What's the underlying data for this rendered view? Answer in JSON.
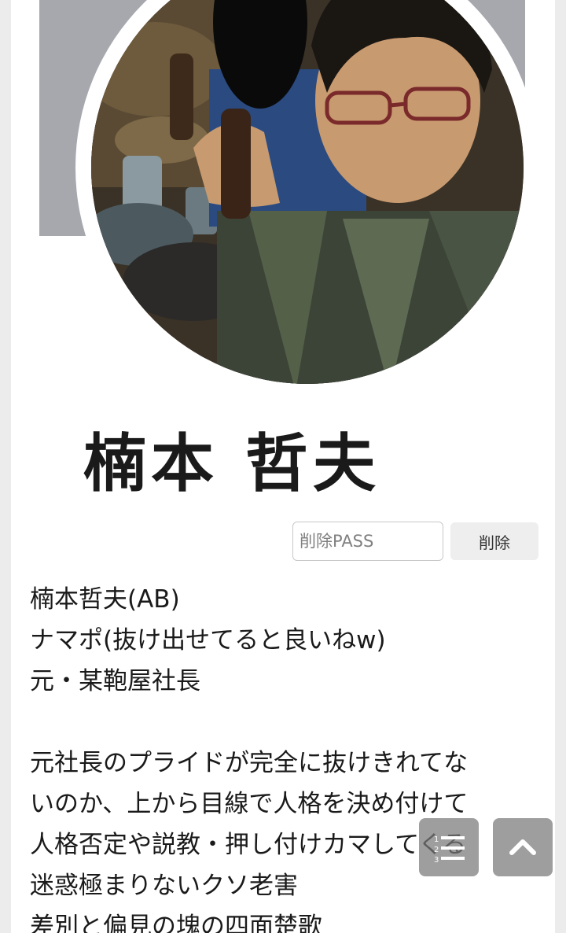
{
  "profile": {
    "name_image_text": "楠本 哲夫"
  },
  "delete_form": {
    "password_placeholder": "削除PASS",
    "delete_label": "削除"
  },
  "post": {
    "lines": [
      "楠本哲夫(AB)",
      "ナマポ(抜け出せてると良いねw)",
      "元・某鞄屋社長",
      "",
      "元社長のプライドが完全に抜けきれてな",
      "いのか、上から目線で人格を決め付けて",
      "人格否定や説教・押し付けカマしてくる",
      "迷惑極まりないクソ老害",
      "差別と偏見の塊の四面楚歌"
    ]
  },
  "icons": {
    "avatar": "profile-photo",
    "list_button": "numbered-list-icon",
    "top_button": "chevron-up-icon"
  },
  "colors": {
    "cover": "#a6a8ae",
    "text": "#1a1a1a",
    "fab": "#787878"
  }
}
